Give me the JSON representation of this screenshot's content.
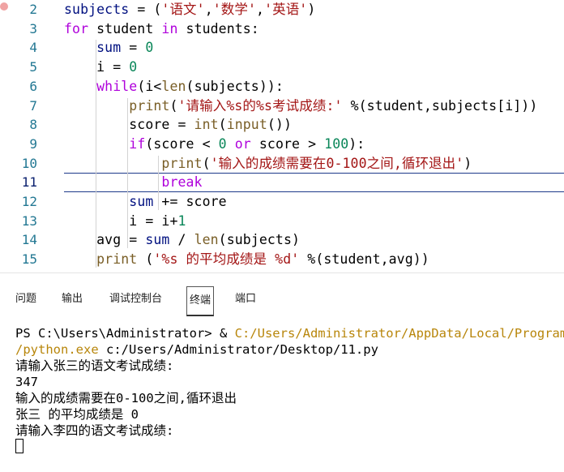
{
  "editor": {
    "lines": [
      {
        "n": "2",
        "tokens": [
          [
            "var",
            "subjects"
          ],
          [
            "op",
            " = ("
          ],
          [
            "str",
            "'语文'"
          ],
          [
            "op",
            ","
          ],
          [
            "str",
            "'数学'"
          ],
          [
            "op",
            ","
          ],
          [
            "str",
            "'英语'"
          ],
          [
            "op",
            ")"
          ]
        ]
      },
      {
        "n": "3",
        "tokens": [
          [
            "kw",
            "for"
          ],
          [
            "op",
            " student "
          ],
          [
            "kw",
            "in"
          ],
          [
            "op",
            " students:"
          ]
        ]
      },
      {
        "n": "4",
        "tokens": [
          [
            "op",
            "    "
          ],
          [
            "var",
            "sum"
          ],
          [
            "op",
            " = "
          ],
          [
            "num",
            "0"
          ]
        ]
      },
      {
        "n": "5",
        "tokens": [
          [
            "op",
            "    i = "
          ],
          [
            "num",
            "0"
          ]
        ]
      },
      {
        "n": "6",
        "tokens": [
          [
            "op",
            "    "
          ],
          [
            "kw",
            "while"
          ],
          [
            "op",
            "(i<"
          ],
          [
            "fn",
            "len"
          ],
          [
            "op",
            "(subjects)):"
          ]
        ]
      },
      {
        "n": "7",
        "tokens": [
          [
            "op",
            "        "
          ],
          [
            "fn",
            "print"
          ],
          [
            "op",
            "("
          ],
          [
            "str",
            "'请输入%s的%s考试成绩:'"
          ],
          [
            "op",
            " %(student,subjects[i]))"
          ]
        ]
      },
      {
        "n": "8",
        "tokens": [
          [
            "op",
            "        score = "
          ],
          [
            "fn",
            "int"
          ],
          [
            "op",
            "("
          ],
          [
            "fn",
            "input"
          ],
          [
            "op",
            "())"
          ]
        ]
      },
      {
        "n": "9",
        "tokens": [
          [
            "op",
            "        "
          ],
          [
            "kw",
            "if"
          ],
          [
            "op",
            "(score < "
          ],
          [
            "num",
            "0"
          ],
          [
            "op",
            " "
          ],
          [
            "kw",
            "or"
          ],
          [
            "op",
            " score > "
          ],
          [
            "num",
            "100"
          ],
          [
            "op",
            "):"
          ]
        ]
      },
      {
        "n": "10",
        "tokens": [
          [
            "op",
            "            "
          ],
          [
            "fn",
            "print"
          ],
          [
            "op",
            "("
          ],
          [
            "str",
            "'输入的成绩需要在0-100之间,循环退出'"
          ],
          [
            "op",
            ")"
          ]
        ]
      },
      {
        "n": "11",
        "tokens": [
          [
            "op",
            "            "
          ],
          [
            "kw",
            "break"
          ]
        ]
      },
      {
        "n": "12",
        "tokens": [
          [
            "op",
            "        "
          ],
          [
            "var",
            "sum"
          ],
          [
            "op",
            " += score"
          ]
        ]
      },
      {
        "n": "13",
        "tokens": [
          [
            "op",
            "        i = i+"
          ],
          [
            "num",
            "1"
          ]
        ]
      },
      {
        "n": "14",
        "tokens": [
          [
            "op",
            "    avg = "
          ],
          [
            "var",
            "sum"
          ],
          [
            "op",
            " / "
          ],
          [
            "fn",
            "len"
          ],
          [
            "op",
            "(subjects)"
          ]
        ]
      },
      {
        "n": "15",
        "tokens": [
          [
            "op",
            "    "
          ],
          [
            "fn",
            "print"
          ],
          [
            "op",
            " ("
          ],
          [
            "str",
            "'%s 的平均成绩是 %d'"
          ],
          [
            "op",
            " %(student,avg))"
          ]
        ]
      }
    ],
    "active_line": "11"
  },
  "panel": {
    "tabs": [
      {
        "label": "问题",
        "active": false
      },
      {
        "label": "输出",
        "active": false
      },
      {
        "label": "调试控制台",
        "active": false
      },
      {
        "label": "终端",
        "active": true
      },
      {
        "label": "端口",
        "active": false
      }
    ]
  },
  "terminal": {
    "prompt": "PS C:\\Users\\Administrator> & ",
    "exe_path_1": "C:/Users/Administrator/AppData/Local/Programs/P",
    "exe_path_2": "/python.exe",
    "script_path": " c:/Users/Administrator/Desktop/11.py",
    "output": [
      "请输入张三的语文考试成绩:",
      "347",
      "输入的成绩需要在0-100之间,循环退出",
      "张三 的平均成绩是 0",
      "请输入李四的语文考试成绩:"
    ]
  }
}
